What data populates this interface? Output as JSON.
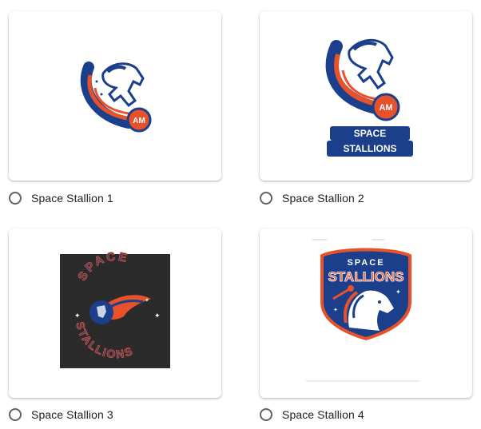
{
  "options": [
    {
      "label": "Space Stallion 1",
      "image_alt": "horse-comet-logo-icon"
    },
    {
      "label": "Space Stallion 2",
      "image_alt": "horse-comet-badge-logo-icon"
    },
    {
      "label": "Space Stallion 3",
      "image_alt": "space-stallions-circular-logo-icon"
    },
    {
      "label": "Space Stallion 4",
      "image_alt": "space-stallions-shield-logo-icon"
    }
  ],
  "logo_text": {
    "monogram": "AM",
    "word1": "SPACE",
    "word2": "STALLIONS"
  },
  "colors": {
    "navy": "#1b3f8b",
    "orange": "#e8522a",
    "radio_border": "#5f6368",
    "label_text": "#202124"
  }
}
